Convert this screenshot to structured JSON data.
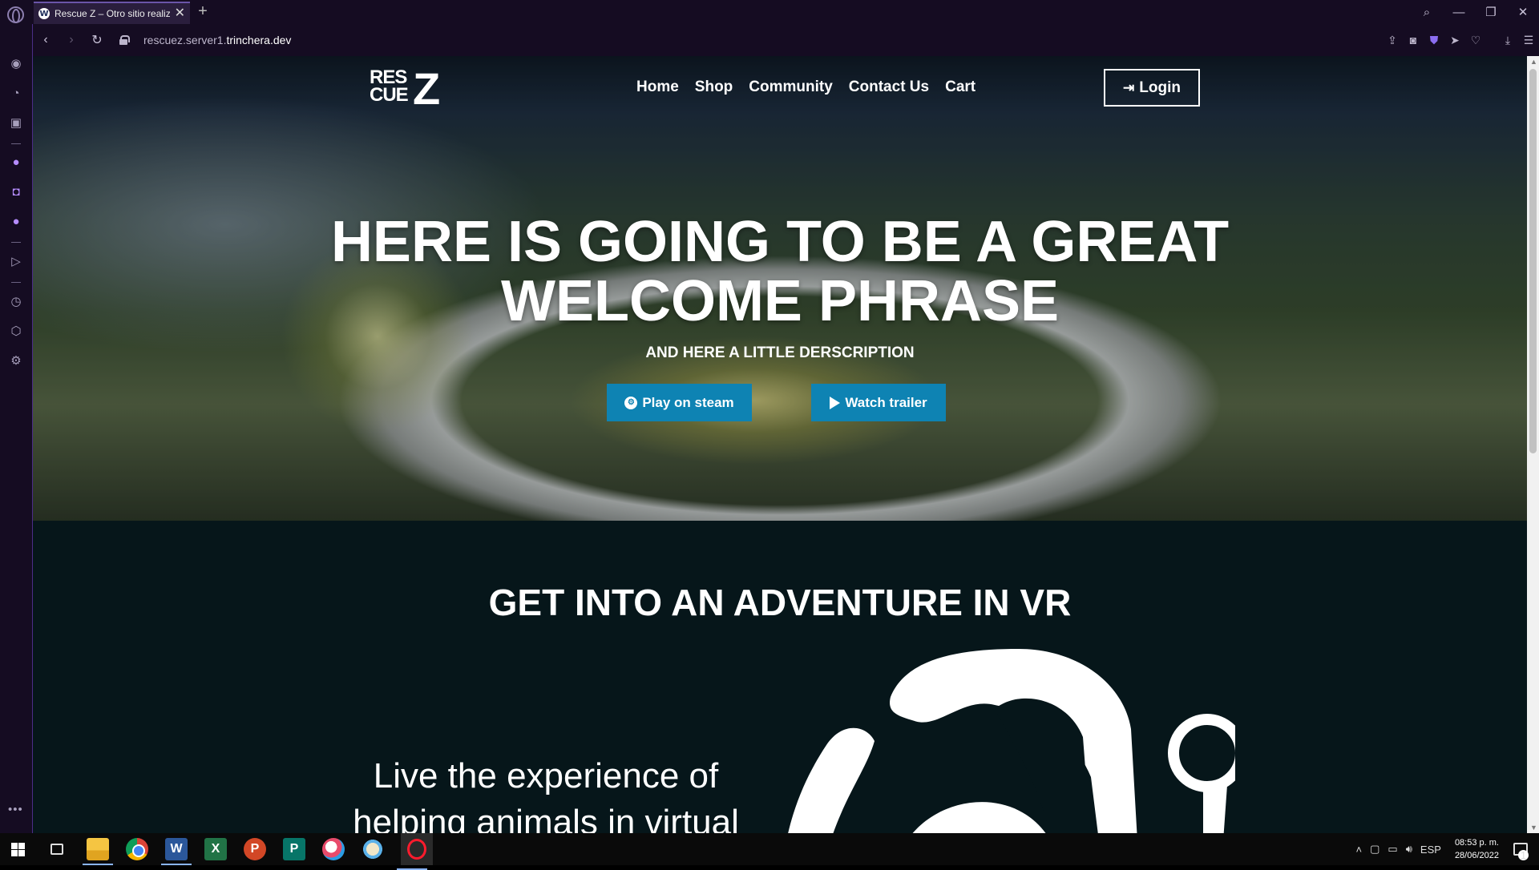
{
  "browser": {
    "tab_title": "Rescue Z – Otro sitio realizado con WordPress",
    "tab_favicon_letter": "W",
    "url_host_prefix": "rescuez.server1.",
    "url_host_domain": "trinchera.dev"
  },
  "site": {
    "logo_top": "RES",
    "logo_bottom": "CUE",
    "logo_letter": "Z",
    "nav": [
      "Home",
      "Shop",
      "Community",
      "Contact Us",
      "Cart"
    ],
    "login_label": "Login"
  },
  "hero": {
    "title_line1": "HERE IS GOING TO BE A GREAT",
    "title_line2": "WELCOME PHRASE",
    "subtitle": "AND HERE A LITTLE DERSCRIPTION",
    "steam_button": "Play on steam",
    "trailer_button": "Watch trailer"
  },
  "section": {
    "title": "GET INTO AN ADVENTURE IN VR",
    "text": "Live the experience of helping animals in virtual"
  },
  "taskbar": {
    "language": "ESP",
    "time": "08:53 p. m.",
    "date": "28/06/2022",
    "notification_count": "1"
  },
  "colors": {
    "accent_button": "#0e83b3",
    "page_background": "#06161a",
    "browser_chrome": "#150c22"
  }
}
